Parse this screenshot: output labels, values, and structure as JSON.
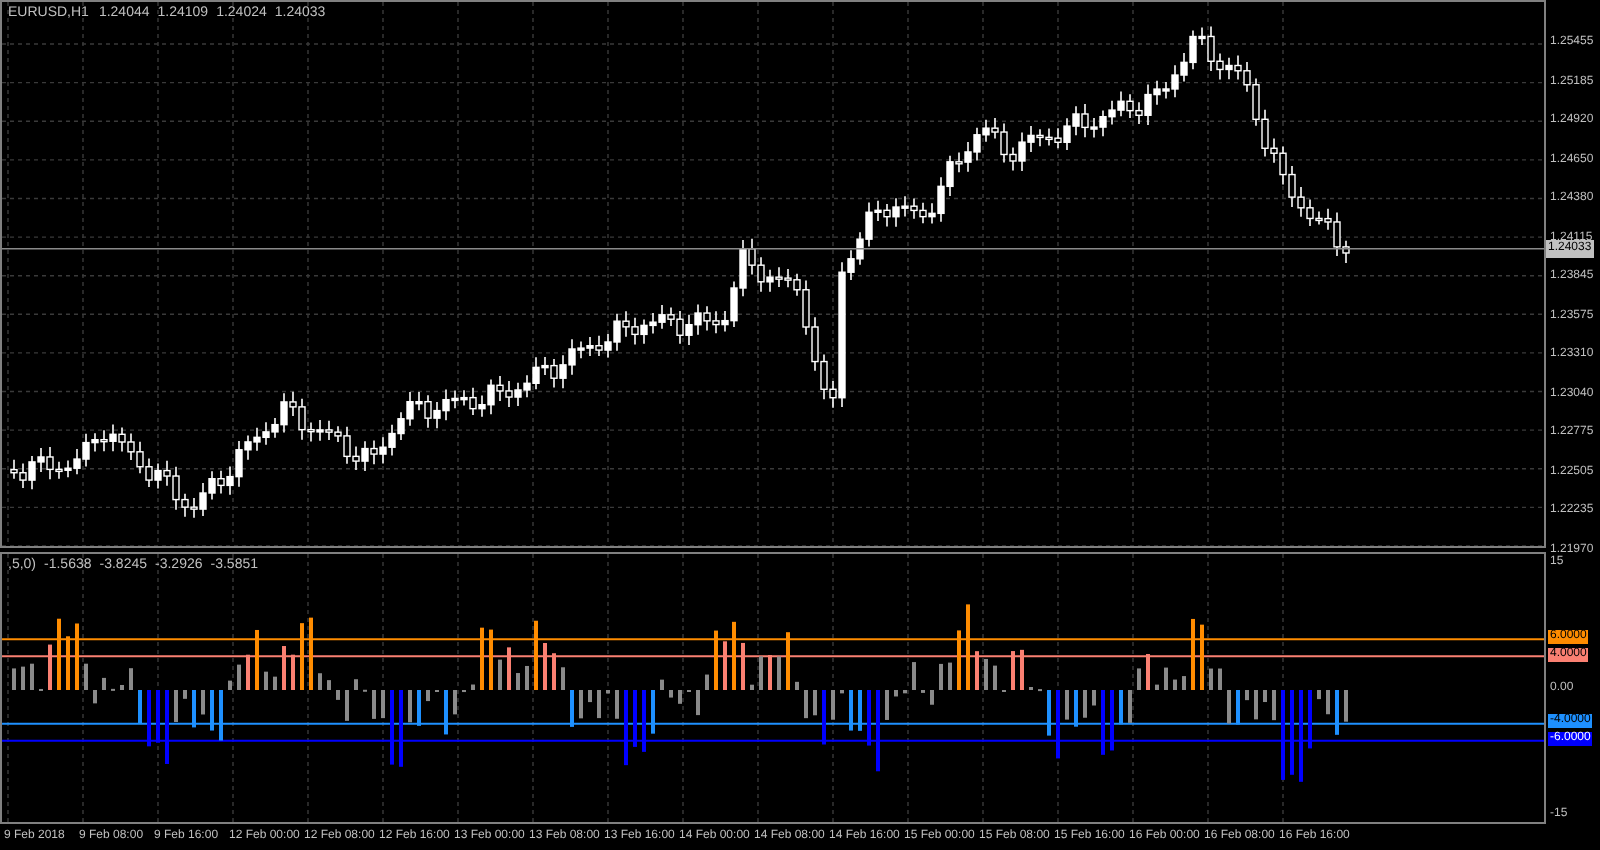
{
  "main_pane": {
    "symbol": "EURUSD,H1",
    "ohlc": [
      "1.24044",
      "1.24109",
      "1.24024",
      "1.24033"
    ],
    "price_axis": [
      "1.25455",
      "1.25185",
      "1.24920",
      "1.24650",
      "1.24380",
      "1.24115",
      "1.23845",
      "1.23575",
      "1.23310",
      "1.23040",
      "1.22775",
      "1.22505",
      "1.22235",
      "1.21970"
    ],
    "current_price": "1.24033"
  },
  "indicator_pane": {
    "params": ",5,0)",
    "values": [
      "-1.5638",
      "-3.8245",
      "-3.2926",
      "-3.5851"
    ],
    "axis": [
      "15",
      "0.00",
      "-15"
    ],
    "levels": [
      {
        "label": "6.0000",
        "color": "#ff8c00"
      },
      {
        "label": "4.0000",
        "color": "#fa8072"
      },
      {
        "label": "-4.0000",
        "color": "#1e90ff"
      },
      {
        "label": "-6.0000",
        "color": "#0000ff"
      }
    ]
  },
  "time_axis": [
    "9 Feb 2018",
    "9 Feb 08:00",
    "9 Feb 16:00",
    "12 Feb 00:00",
    "12 Feb 08:00",
    "12 Feb 16:00",
    "13 Feb 00:00",
    "13 Feb 08:00",
    "13 Feb 16:00",
    "14 Feb 00:00",
    "14 Feb 08:00",
    "14 Feb 16:00",
    "15 Feb 00:00",
    "15 Feb 08:00",
    "15 Feb 16:00",
    "16 Feb 00:00",
    "16 Feb 08:00",
    "16 Feb 16:00"
  ]
}
